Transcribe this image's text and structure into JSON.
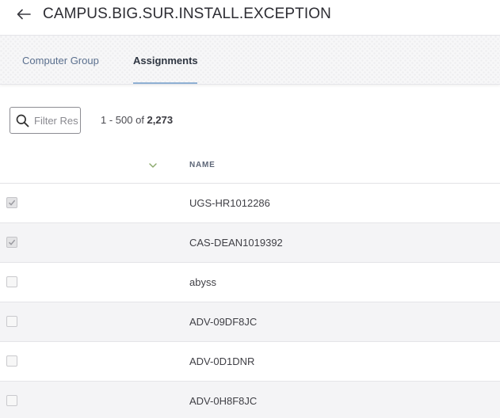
{
  "header": {
    "title": "CAMPUS.BIG.SUR.INSTALL.EXCEPTION",
    "back_icon": "arrow-left-icon"
  },
  "tabs": [
    {
      "label": "Computer Group",
      "active": false
    },
    {
      "label": "Assignments",
      "active": true
    }
  ],
  "filter": {
    "placeholder": "Filter Results",
    "value": "",
    "icon": "search-icon"
  },
  "pagination": {
    "range": "1 - 500 of ",
    "total": "2,273"
  },
  "table": {
    "sort_icon": "chevron-down-icon",
    "columns": [
      "NAME"
    ],
    "rows": [
      {
        "name": "UGS-HR1012286",
        "checked": true
      },
      {
        "name": "CAS-DEAN1019392",
        "checked": true
      },
      {
        "name": "abyss",
        "checked": false
      },
      {
        "name": "ADV-09DF8JC",
        "checked": false
      },
      {
        "name": "ADV-0D1DNR",
        "checked": false
      },
      {
        "name": "ADV-0H8F8JC",
        "checked": false
      }
    ]
  },
  "colors": {
    "accent_underline": "#8fb0d3",
    "inactive_tab": "#5a6f8e",
    "sort_chevron": "#8aa86b"
  }
}
